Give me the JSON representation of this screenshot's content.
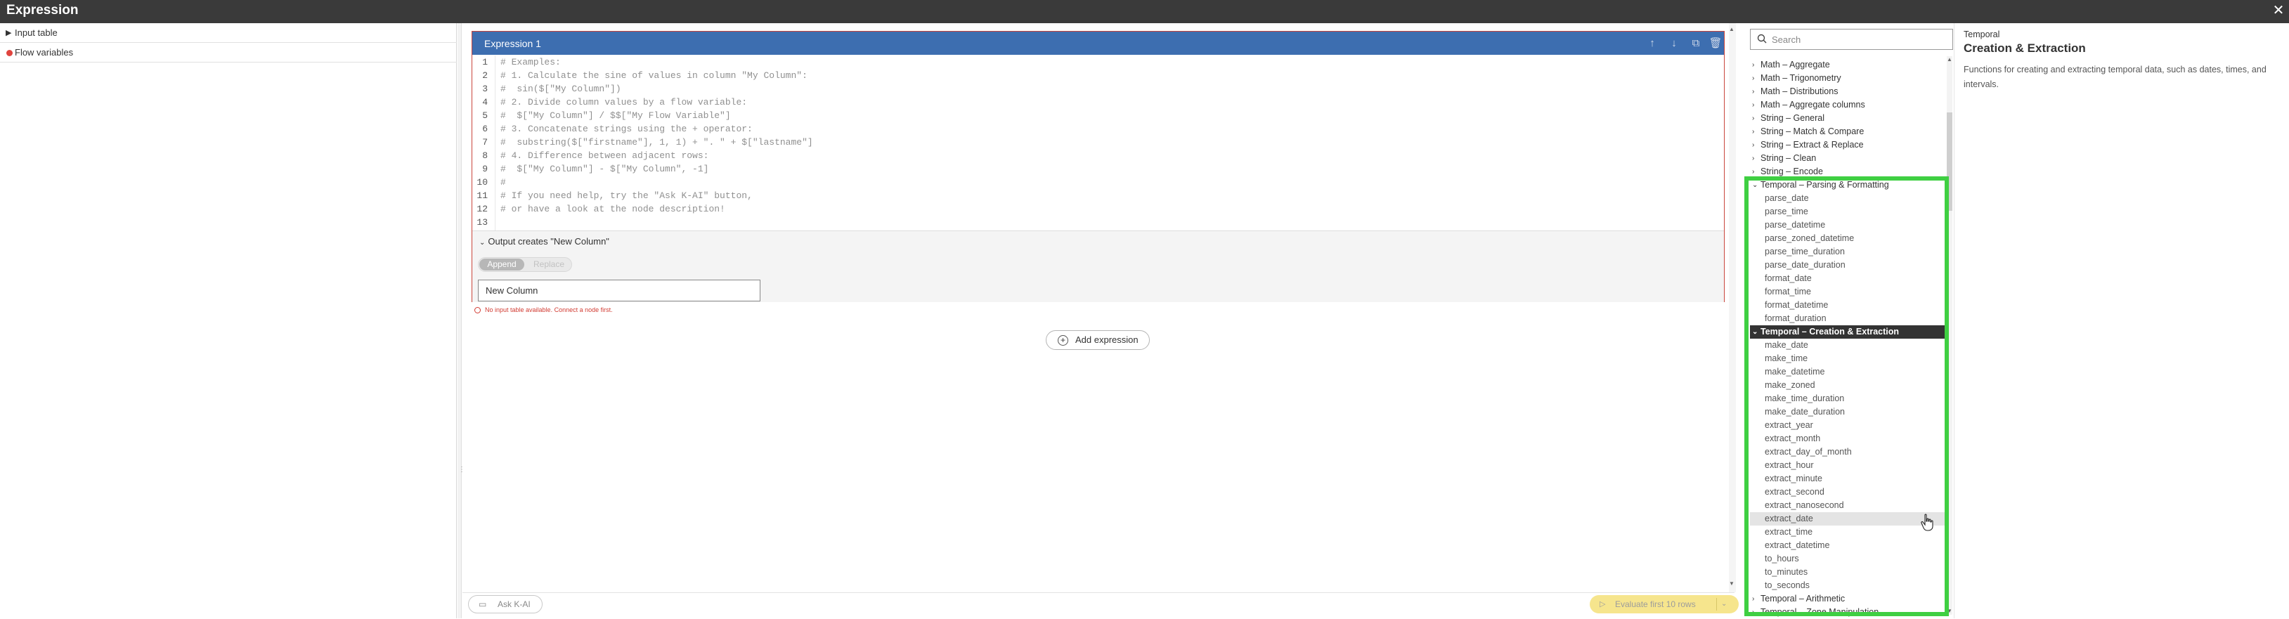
{
  "window": {
    "title": "Expression",
    "close_icon": "close-icon"
  },
  "left_panel": {
    "items": [
      {
        "label": "Input table",
        "icon": "caret-right-icon"
      },
      {
        "label": "Flow variables",
        "icon": "red-dot-icon",
        "color": "#e0443e"
      }
    ]
  },
  "editor": {
    "expression_title": "Expression 1",
    "header_color": "#3d6eb0",
    "header_icons": [
      "move-up-icon",
      "move-down-icon",
      "copy-icon",
      "delete-icon"
    ],
    "code_lines": [
      {
        "n": "1",
        "text": "# Examples:"
      },
      {
        "n": "2",
        "text": "# 1. Calculate the sine of values in column \"My Column\":"
      },
      {
        "n": "3",
        "text": "#  sin($[\"My Column\"])"
      },
      {
        "n": "4",
        "text": "# 2. Divide column values by a flow variable:"
      },
      {
        "n": "5",
        "text": "#  $[\"My Column\"] / $$[\"My Flow Variable\"]"
      },
      {
        "n": "6",
        "text": "# 3. Concatenate strings using the + operator:"
      },
      {
        "n": "7",
        "text": "#  substring($[\"firstname\"], 1, 1) + \". \" + $[\"lastname\"]"
      },
      {
        "n": "8",
        "text": "# 4. Difference between adjacent rows:"
      },
      {
        "n": "9",
        "text": "#  $[\"My Column\"] - $[\"My Column\", -1]"
      },
      {
        "n": "10",
        "text": "#"
      },
      {
        "n": "11",
        "text": "# If you need help, try the \"Ask K-AI\" button,"
      },
      {
        "n": "12",
        "text": "# or have a look at the node description!"
      },
      {
        "n": "13",
        "text": ""
      }
    ],
    "output_header": "Output creates \"New Column\"",
    "mode_append": "Append",
    "mode_replace": "Replace",
    "column_name": "New Column",
    "warning": "No input table available. Connect a node first.",
    "add_expression": "Add expression",
    "ask_kai": "Ask K-AI",
    "evaluate": "Evaluate first 10 rows",
    "error_color": "#d23c33",
    "evaluate_color": "#f6e58d"
  },
  "catalog": {
    "search_placeholder": "Search",
    "categories_before": [
      "Math – Aggregate",
      "Math – Trigonometry",
      "Math – Distributions",
      "Math – Aggregate columns",
      "String – General",
      "String – Match & Compare",
      "String – Extract & Replace",
      "String – Clean",
      "String – Encode"
    ],
    "parsing_category": "Temporal – Parsing & Formatting",
    "parsing_functions": [
      "parse_date",
      "parse_time",
      "parse_datetime",
      "parse_zoned_datetime",
      "parse_time_duration",
      "parse_date_duration",
      "format_date",
      "format_time",
      "format_datetime",
      "format_duration"
    ],
    "creation_category": "Temporal – Creation & Extraction",
    "creation_functions": [
      "make_date",
      "make_time",
      "make_datetime",
      "make_zoned",
      "make_time_duration",
      "make_date_duration",
      "extract_year",
      "extract_month",
      "extract_day_of_month",
      "extract_hour",
      "extract_minute",
      "extract_second",
      "extract_nanosecond",
      "extract_date",
      "extract_time",
      "extract_datetime",
      "to_hours",
      "to_minutes",
      "to_seconds"
    ],
    "hovered_function": "extract_date",
    "categories_after": [
      "Temporal – Arithmetic",
      "Temporal – Zone Manipulation"
    ],
    "highlight_color": "#3fcf42"
  },
  "description": {
    "category": "Temporal",
    "title": "Creation & Extraction",
    "text": "Functions for creating and extracting temporal data, such as dates, times, and intervals."
  }
}
